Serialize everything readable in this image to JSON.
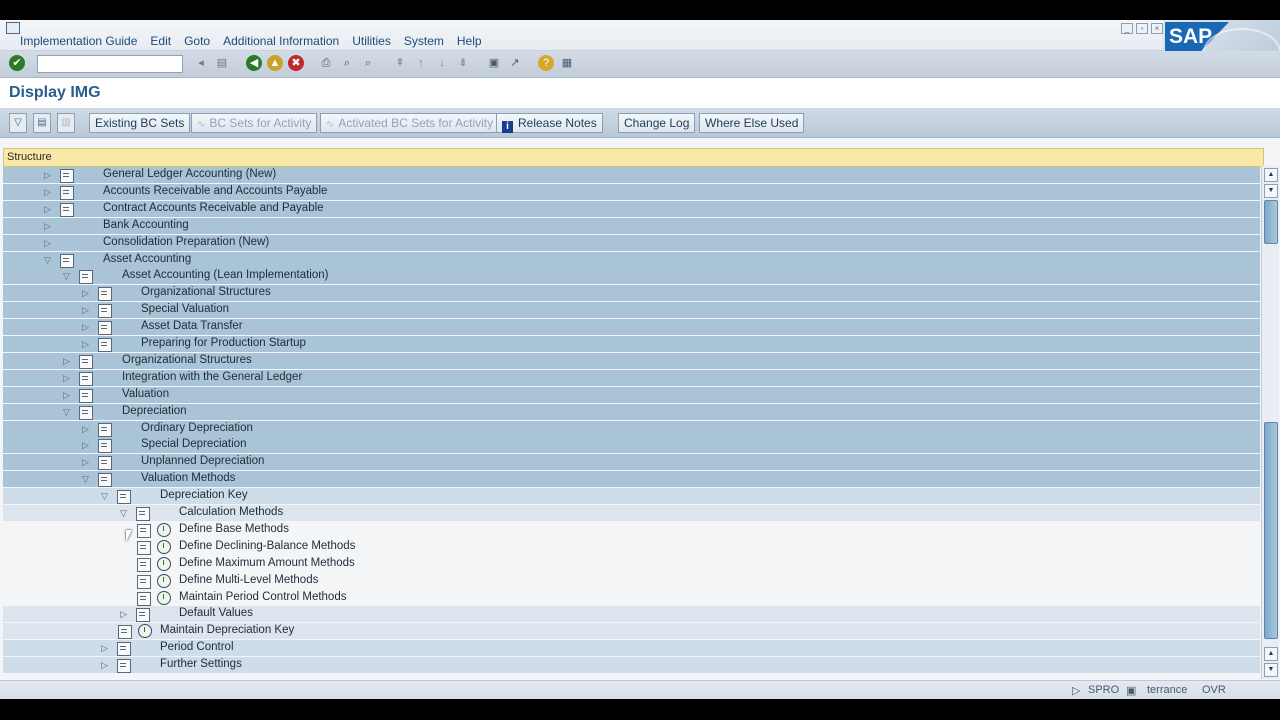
{
  "menu": {
    "items": [
      {
        "label": "Implementation Guide"
      },
      {
        "label": "Edit"
      },
      {
        "label": "Goto"
      },
      {
        "label": "Additional Information"
      },
      {
        "label": "Utilities"
      },
      {
        "label": "System"
      },
      {
        "label": "Help"
      }
    ]
  },
  "logo": {
    "text": "SAP"
  },
  "title": "Display IMG",
  "app_toolbar": {
    "existing_bc_sets": "Existing BC Sets",
    "bc_sets_for_activity": "BC Sets for Activity",
    "activated_bc_sets": "Activated BC Sets for Activity",
    "release_notes": "Release Notes",
    "change_log": "Change Log",
    "where_else_used": "Where Else Used"
  },
  "structure_header": "Structure",
  "tree": [
    {
      "label": "General Ledger Accounting (New)",
      "level": 0,
      "expanded": false,
      "icon": "doc"
    },
    {
      "label": "Accounts Receivable and Accounts Payable",
      "level": 0,
      "expanded": false,
      "icon": "doc"
    },
    {
      "label": "Contract Accounts Receivable and Payable",
      "level": 0,
      "expanded": false,
      "icon": "doc"
    },
    {
      "label": "Bank Accounting",
      "level": 0,
      "expanded": false,
      "icon": "none"
    },
    {
      "label": "Consolidation Preparation (New)",
      "level": 0,
      "expanded": false,
      "icon": "none"
    },
    {
      "label": "Asset Accounting",
      "level": 0,
      "expanded": true,
      "icon": "doc"
    },
    {
      "label": "Asset Accounting (Lean Implementation)",
      "level": 1,
      "expanded": true,
      "icon": "doc"
    },
    {
      "label": "Organizational Structures",
      "level": 2,
      "expanded": false,
      "icon": "doc"
    },
    {
      "label": "Special Valuation",
      "level": 2,
      "expanded": false,
      "icon": "doc"
    },
    {
      "label": "Asset Data Transfer",
      "level": 2,
      "expanded": false,
      "icon": "doc"
    },
    {
      "label": "Preparing for Production Startup",
      "level": 2,
      "expanded": false,
      "icon": "doc"
    },
    {
      "label": "Organizational Structures",
      "level": 1,
      "expanded": false,
      "icon": "doc"
    },
    {
      "label": "Integration with the General Ledger",
      "level": 1,
      "expanded": false,
      "icon": "doc"
    },
    {
      "label": "Valuation",
      "level": 1,
      "expanded": false,
      "icon": "doc"
    },
    {
      "label": "Depreciation",
      "level": 1,
      "expanded": true,
      "icon": "doc"
    },
    {
      "label": "Ordinary Depreciation",
      "level": 2,
      "expanded": false,
      "icon": "doc"
    },
    {
      "label": "Special Depreciation",
      "level": 2,
      "expanded": false,
      "icon": "doc"
    },
    {
      "label": "Unplanned Depreciation",
      "level": 2,
      "expanded": false,
      "icon": "doc"
    },
    {
      "label": "Valuation Methods",
      "level": 2,
      "expanded": true,
      "icon": "doc"
    },
    {
      "label": "Depreciation Key",
      "level": 3,
      "expanded": true,
      "icon": "doc"
    },
    {
      "label": "Calculation Methods",
      "level": 4,
      "expanded": true,
      "icon": "doc"
    },
    {
      "label": "Define Base Methods",
      "level": 5,
      "expanded": null,
      "icon": "exec"
    },
    {
      "label": "Define Declining-Balance Methods",
      "level": 5,
      "expanded": null,
      "icon": "exec"
    },
    {
      "label": "Define Maximum Amount Methods",
      "level": 5,
      "expanded": null,
      "icon": "exec"
    },
    {
      "label": "Define Multi-Level Methods",
      "level": 5,
      "expanded": null,
      "icon": "exec"
    },
    {
      "label": "Maintain Period Control Methods",
      "level": 5,
      "expanded": null,
      "icon": "exec"
    },
    {
      "label": "Default Values",
      "level": 4,
      "expanded": false,
      "icon": "doc"
    },
    {
      "label": "Maintain Depreciation Key",
      "level": 4,
      "expanded": null,
      "icon": "exec"
    },
    {
      "label": "Period Control",
      "level": 3,
      "expanded": false,
      "icon": "doc"
    },
    {
      "label": "Further Settings",
      "level": 3,
      "expanded": false,
      "icon": "doc"
    }
  ],
  "status": {
    "transaction": "SPRO",
    "user": "terrance",
    "mode": "OVR"
  },
  "colors": {
    "accent": "#2b5d8c",
    "tree_bg": "#a9c4d6",
    "header_yellow": "#f9e9a8"
  }
}
